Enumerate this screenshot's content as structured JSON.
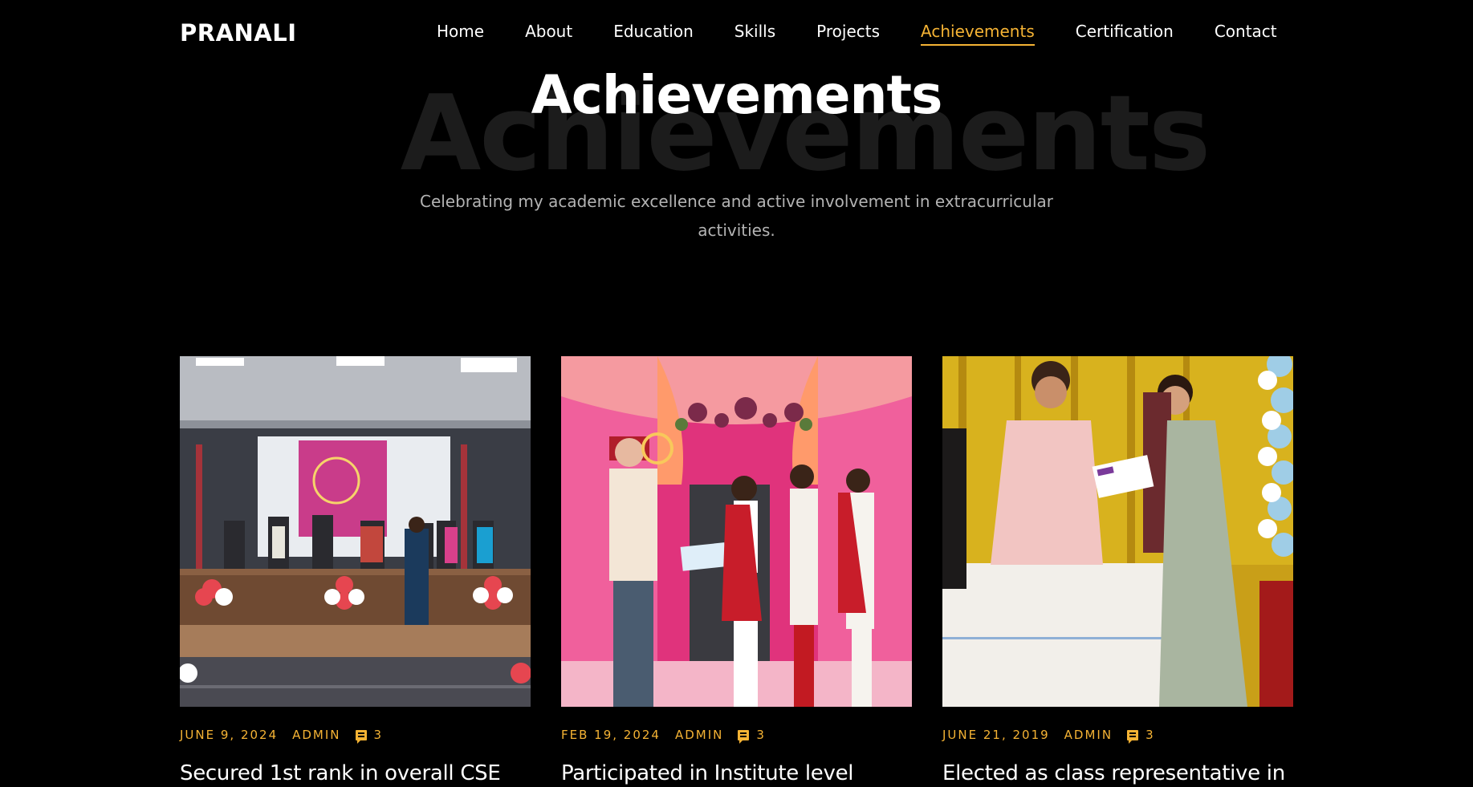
{
  "brand": {
    "logo": "PRANALI"
  },
  "nav": {
    "items": [
      {
        "label": "Home"
      },
      {
        "label": "About"
      },
      {
        "label": "Education"
      },
      {
        "label": "Skills"
      },
      {
        "label": "Projects"
      },
      {
        "label": "Achievements",
        "active": true
      },
      {
        "label": "Certification"
      },
      {
        "label": "Contact"
      }
    ]
  },
  "header": {
    "title": "Achievements",
    "title_watermark": "Achievements",
    "subtitle_line1": "Celebrating my academic excellence and active involvement in extracurricular",
    "subtitle_line2": "activities."
  },
  "colors": {
    "accent": "#f5b334",
    "background": "#000000",
    "muted": "#b3b3b3"
  },
  "posts": [
    {
      "date": "JUNE 9, 2024",
      "author": "ADMIN",
      "comments": "3",
      "comment_icon": "comment-icon",
      "title": "Secured 1st rank in overall CSE"
    },
    {
      "date": "FEB 19, 2024",
      "author": "ADMIN",
      "comments": "3",
      "comment_icon": "comment-icon",
      "title": "Participated in Institute level"
    },
    {
      "date": "JUNE 21, 2019",
      "author": "ADMIN",
      "comments": "3",
      "comment_icon": "comment-icon",
      "title": "Elected as class representative in"
    }
  ]
}
